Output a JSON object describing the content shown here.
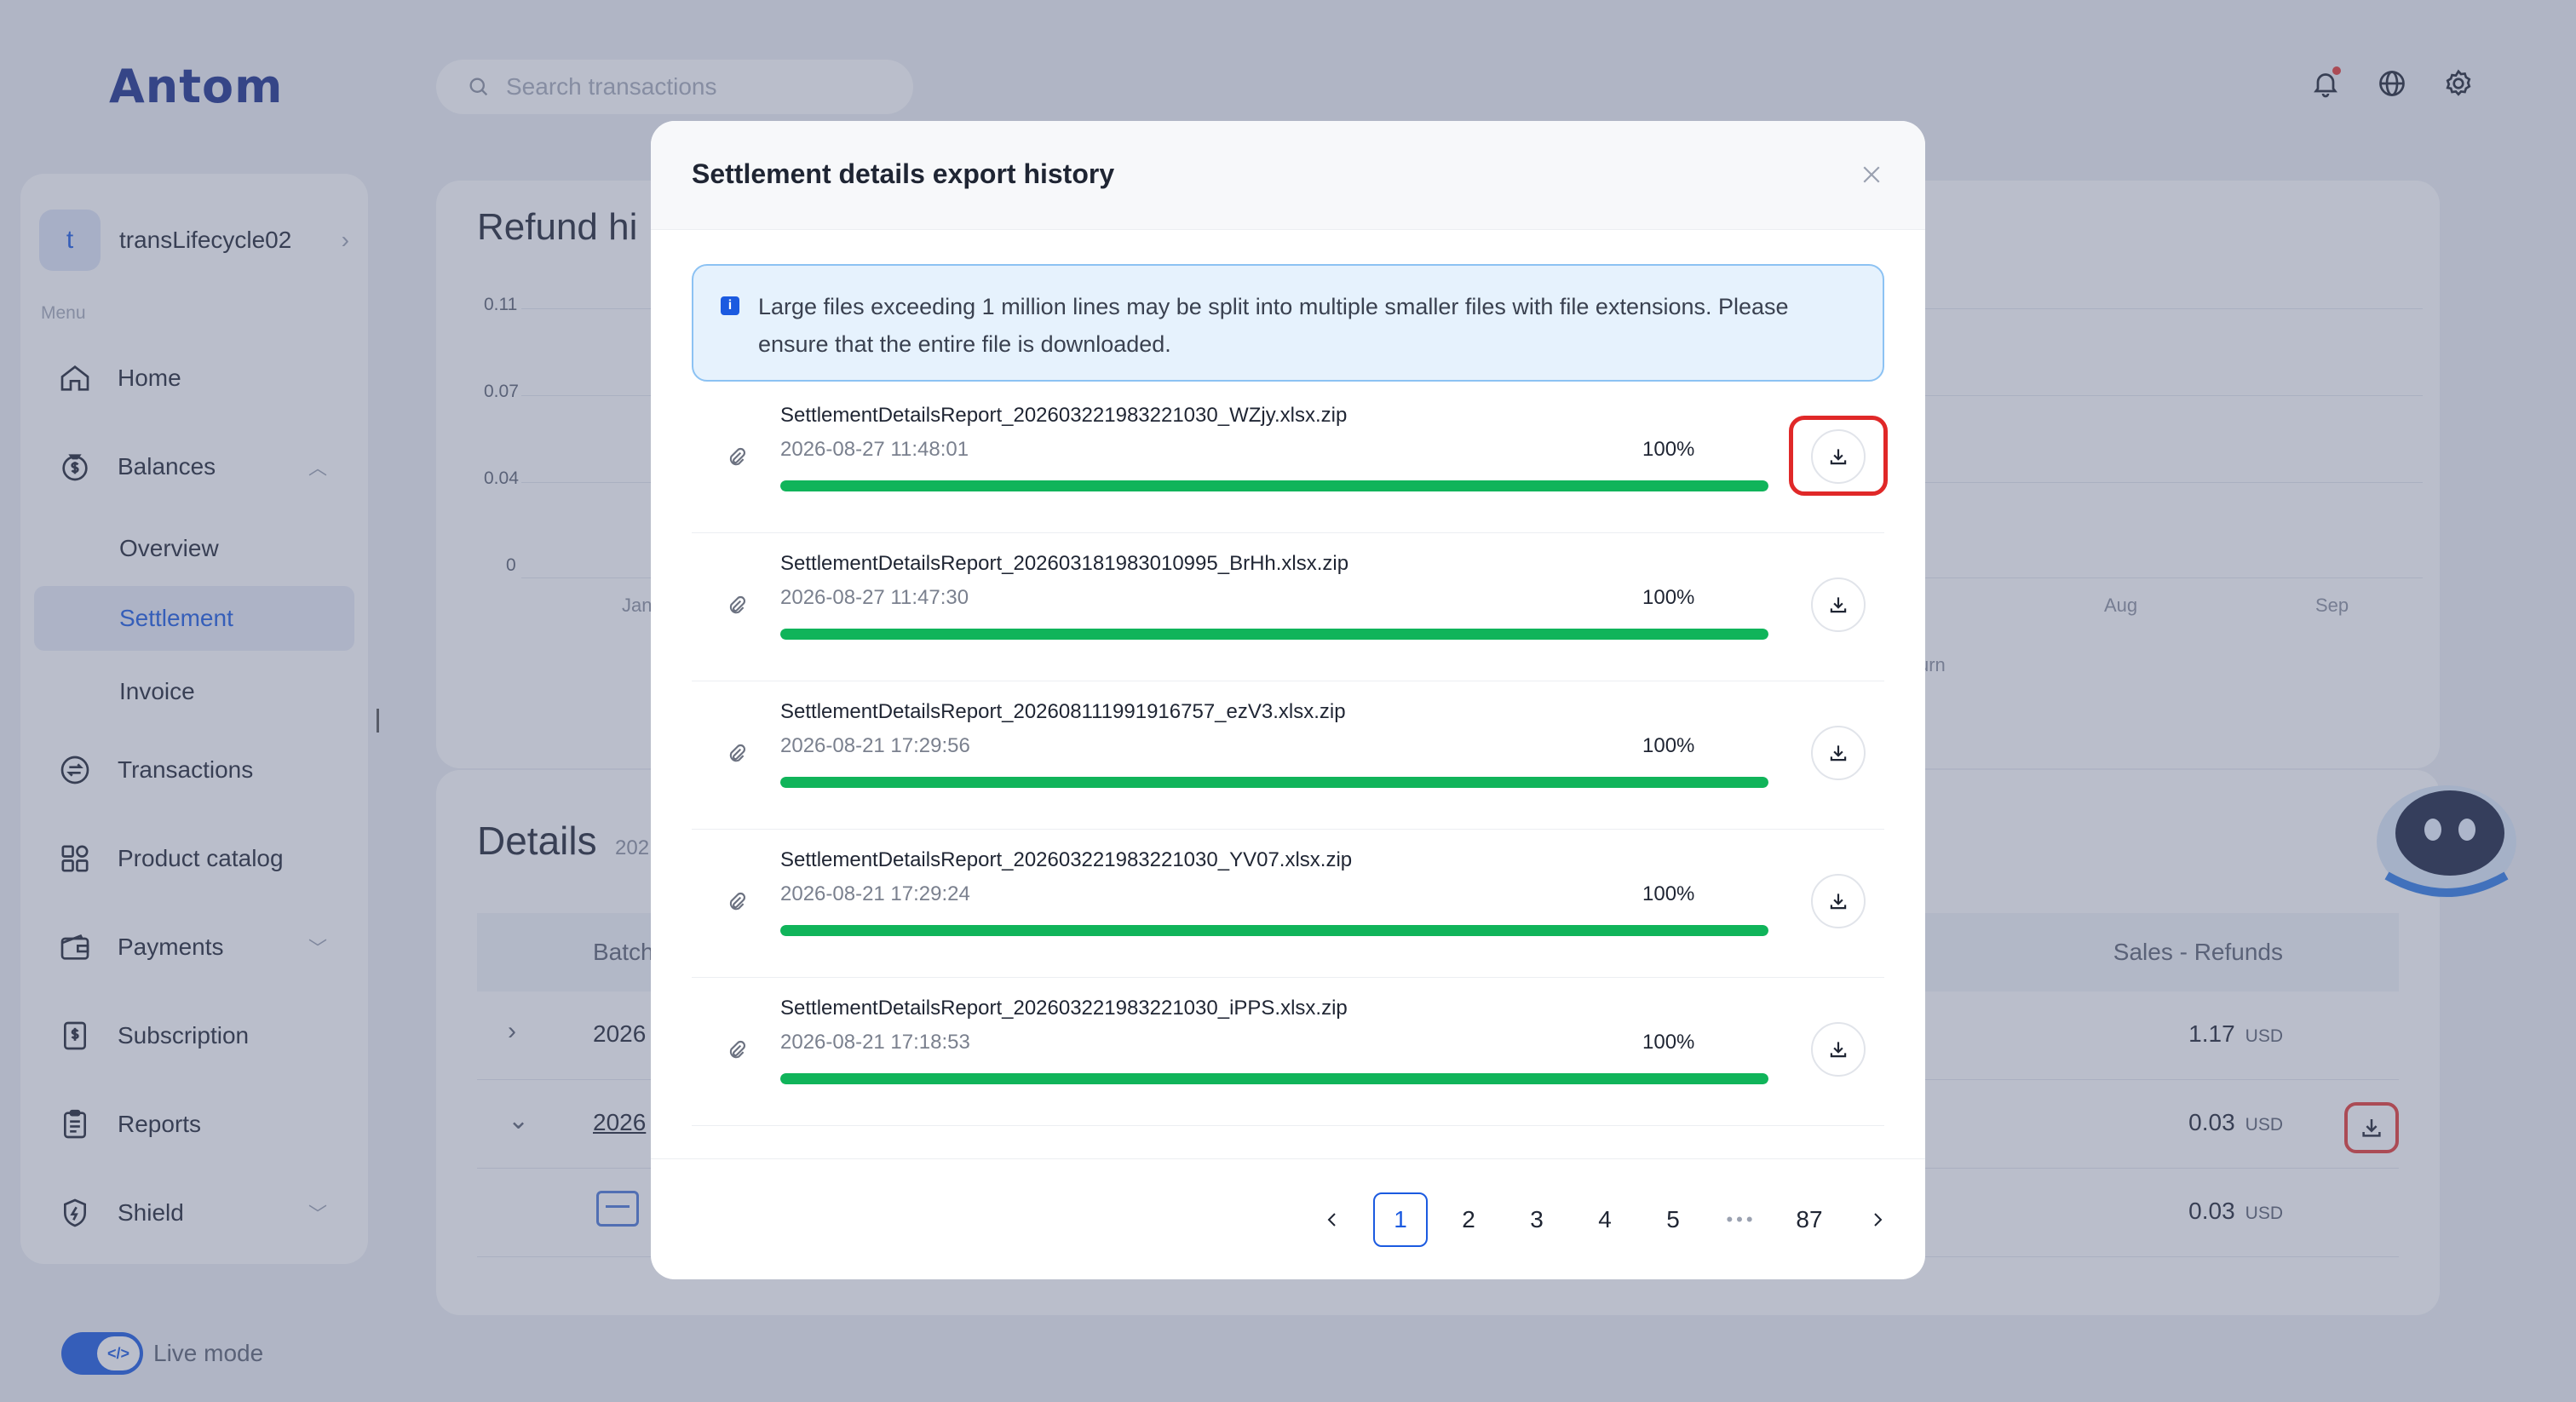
{
  "brand": {
    "logo": "Antom"
  },
  "search": {
    "placeholder": "Search transactions"
  },
  "sidebar": {
    "account": {
      "initial": "t",
      "name": "transLifecycle02"
    },
    "menu_label": "Menu",
    "items": [
      {
        "label": "Home"
      },
      {
        "label": "Balances"
      },
      {
        "label": "Overview"
      },
      {
        "label": "Settlement"
      },
      {
        "label": "Invoice"
      },
      {
        "label": "Transactions"
      },
      {
        "label": "Product catalog"
      },
      {
        "label": "Payments"
      },
      {
        "label": "Subscription"
      },
      {
        "label": "Reports"
      },
      {
        "label": "Shield"
      }
    ],
    "live_mode": "Live mode"
  },
  "refund_card": {
    "title": "Refund hi",
    "y_ticks": [
      "0.11",
      "0.07",
      "0.04",
      "0"
    ],
    "x_ticks": [
      "Jan",
      "Aug",
      "Sep"
    ],
    "legend_fragment": "urn"
  },
  "details_card": {
    "title": "Details",
    "subtitle": "202",
    "col_batch": "Batch",
    "col_sales": "Sales - Refunds",
    "rows": [
      {
        "batch": "2026",
        "amount": "1.17",
        "currency": "USD"
      },
      {
        "batch": "2026",
        "amount": "0.03",
        "currency": "USD"
      },
      {
        "batch": "",
        "amount": "0.03",
        "currency": "USD"
      }
    ]
  },
  "modal": {
    "title": "Settlement details export history",
    "notice": "Large files exceeding 1 million lines may be split into multiple smaller files with file extensions. Please ensure that the entire file is downloaded.",
    "files": [
      {
        "name": "SettlementDetailsReport_202603221983221030_WZjy.xlsx.zip",
        "date": "2026-08-27 11:48:01",
        "progress": "100%"
      },
      {
        "name": "SettlementDetailsReport_202603181983010995_BrHh.xlsx.zip",
        "date": "2026-08-27 11:47:30",
        "progress": "100%"
      },
      {
        "name": "SettlementDetailsReport_202608111991916757_ezV3.xlsx.zip",
        "date": "2026-08-21 17:29:56",
        "progress": "100%"
      },
      {
        "name": "SettlementDetailsReport_202603221983221030_YV07.xlsx.zip",
        "date": "2026-08-21 17:29:24",
        "progress": "100%"
      },
      {
        "name": "SettlementDetailsReport_202603221983221030_iPPS.xlsx.zip",
        "date": "2026-08-21 17:18:53",
        "progress": "100%"
      }
    ],
    "pagination": {
      "pages": [
        "1",
        "2",
        "3",
        "4",
        "5"
      ],
      "ellipsis": "•••",
      "last": "87",
      "current": "1"
    }
  },
  "colors": {
    "accent": "#1b5ae0",
    "progress": "#10b45a",
    "highlight": "#e02828"
  }
}
